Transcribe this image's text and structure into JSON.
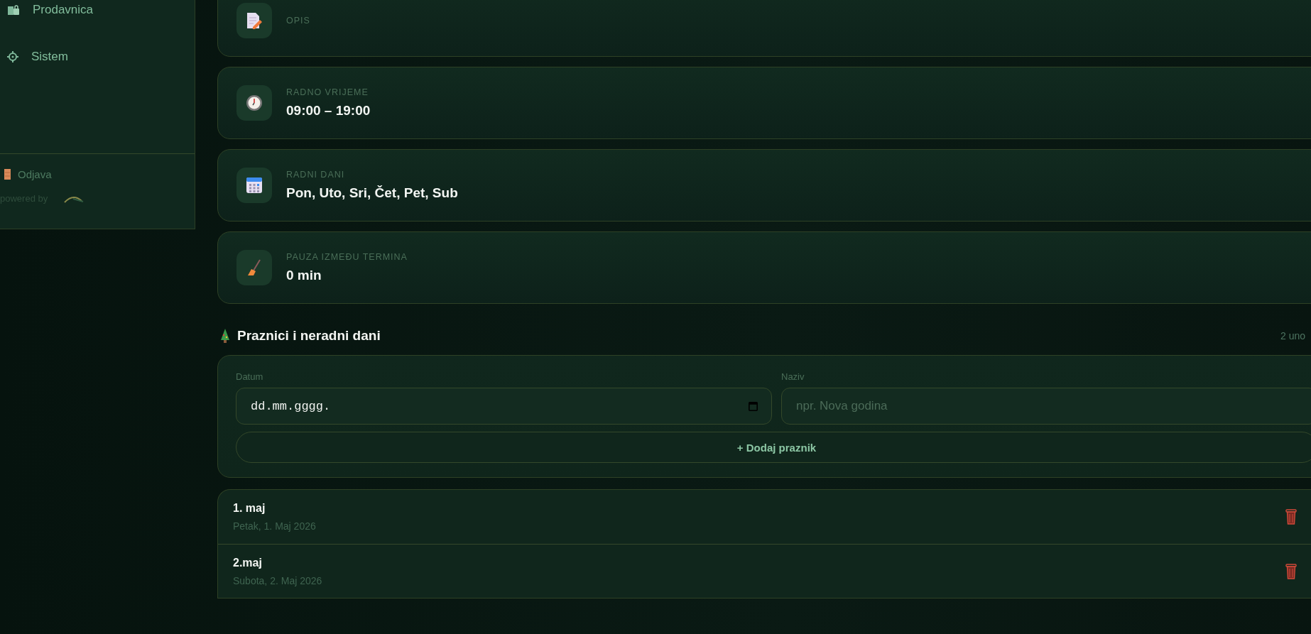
{
  "sidebar": {
    "items": [
      {
        "kind": "shop",
        "label": "Prodavnica"
      },
      {
        "kind": "gear",
        "label": "Sistem"
      }
    ],
    "logout": "Odjava",
    "powered_by": "powered by"
  },
  "info_cards": [
    {
      "kind": "description",
      "label": "OPIS"
    },
    {
      "kind": "hours",
      "label": "RADNO VRIJEME",
      "value": "09:00 – 19:00"
    },
    {
      "kind": "days",
      "label": "RADNI DANI",
      "value": "Pon, Uto, Sri, Čet, Pet, Sub"
    },
    {
      "kind": "pause",
      "label": "PAUZA IZMEĐU TERMINA",
      "value": "0 min"
    }
  ],
  "holidays": {
    "title": "Praznici i neradni dani",
    "count": "2 uno",
    "form": {
      "date_label": "Datum",
      "date_value": "dd.mm.gggg.",
      "name_label": "Naziv",
      "name_placeholder": "npr. Nova godina",
      "add_button": "+ Dodaj praznik"
    },
    "items": [
      {
        "name": "1. maj",
        "date": "Petak, 1. Maj 2026"
      },
      {
        "name": "2.maj",
        "date": "Subota, 2. Maj 2026"
      }
    ]
  }
}
